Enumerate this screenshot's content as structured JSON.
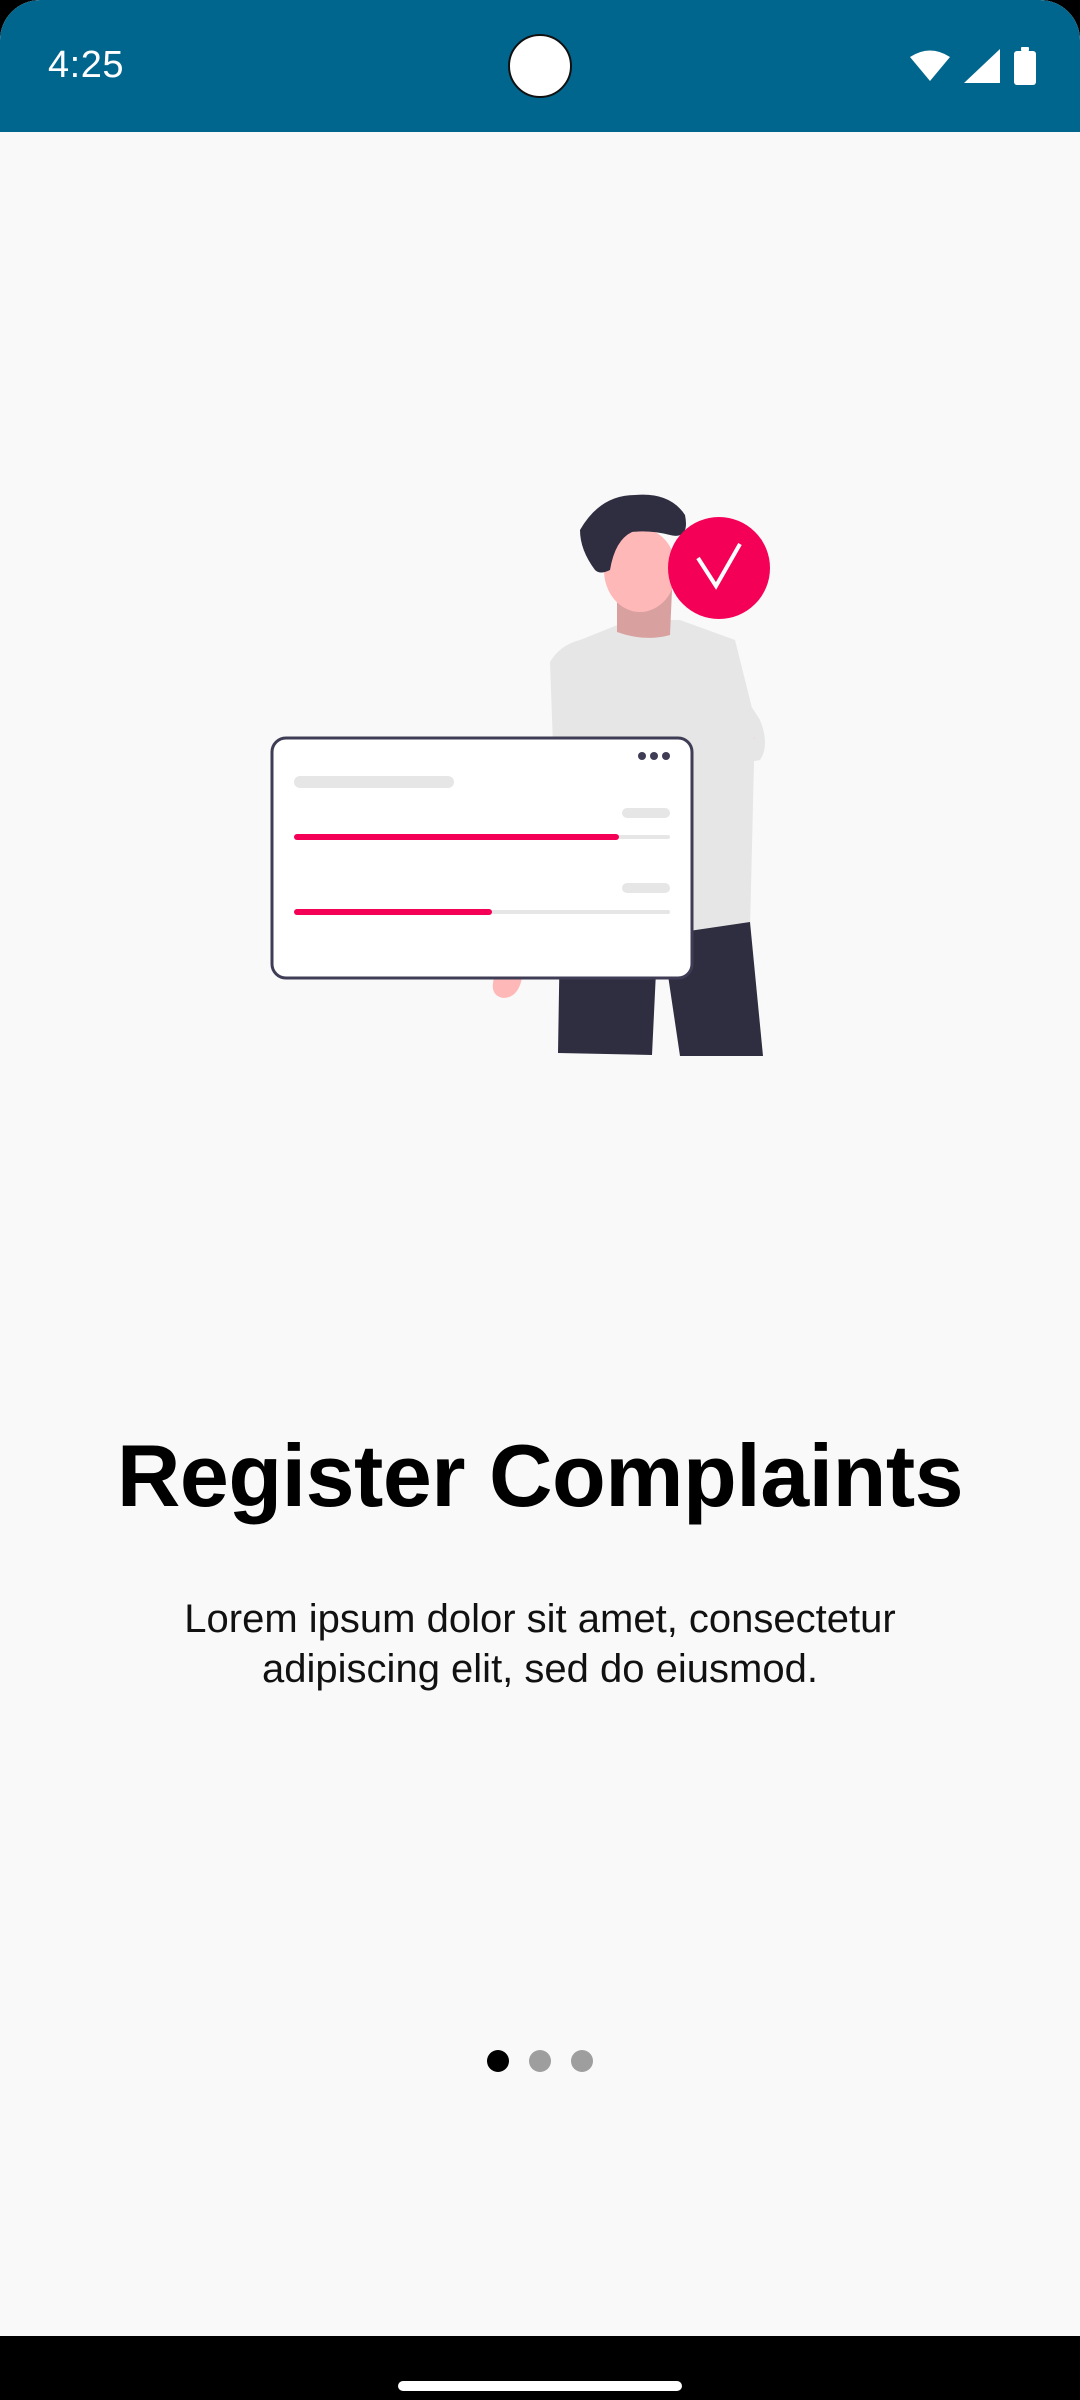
{
  "status_bar": {
    "time": "4:25",
    "icons": [
      "wifi-icon",
      "cellular-signal-icon",
      "battery-icon"
    ],
    "background": "#00668e"
  },
  "onboarding": {
    "illustration": "person-holding-form-with-checkmark",
    "title": "Register Complaints",
    "description": "Lorem ipsum dolor sit amet, consectetur adipiscing elit, sed do eiusmod.",
    "page_indicator": {
      "total": 3,
      "current": 1
    }
  },
  "colors": {
    "accent": "#f50057",
    "dark": "#2f2e41",
    "background": "#f9f9f9"
  }
}
